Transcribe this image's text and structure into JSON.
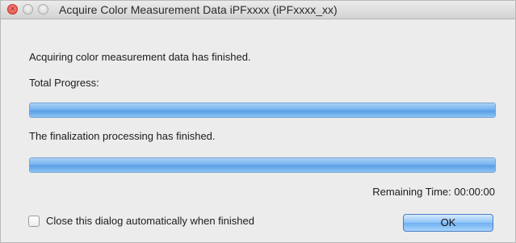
{
  "window": {
    "title": "Acquire Color Measurement Data iPFxxxx (iPFxxxx_xx)",
    "controls": {
      "close_icon": "close-icon",
      "close_glyph": "×",
      "minimize_icon": "minimize-icon",
      "zoom_icon": "zoom-icon"
    }
  },
  "status": {
    "acquiring_message": "Acquiring color measurement data has finished.",
    "total_progress_label": "Total Progress:",
    "total_progress_value": 1.0,
    "finalization_message": "The finalization processing has finished.",
    "finalization_progress_value": 1.0,
    "remaining_time": "Remaining Time: 00:00:00"
  },
  "footer": {
    "auto_close_label": "Close this dialog automatically when finished",
    "auto_close_checked": false,
    "ok_label": "OK"
  },
  "colors": {
    "progress_fill": "#77b3ee",
    "button_accent": "#6fb0f2",
    "close_button": "#e0443b"
  }
}
